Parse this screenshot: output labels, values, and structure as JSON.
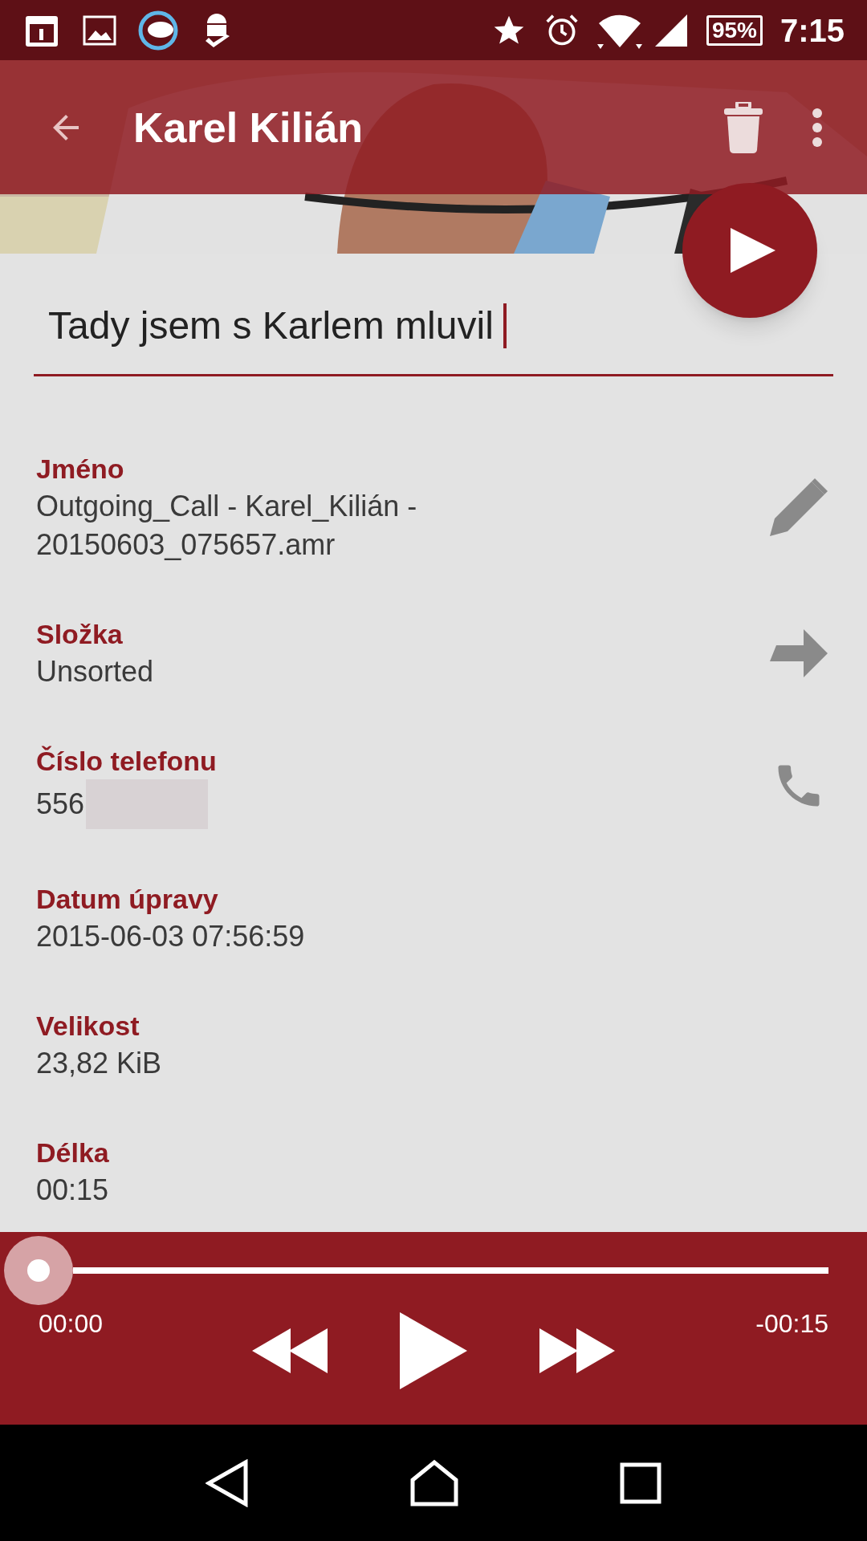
{
  "status_bar": {
    "battery": "95%",
    "time": "7:15"
  },
  "toolbar": {
    "title": "Karel Kilián"
  },
  "note_field": {
    "value": "Tady jsem s Karlem mluvil"
  },
  "fields": [
    {
      "label": "Jméno",
      "value": "Outgoing_Call - Karel_Kilián - 20150603_075657.amr",
      "kind": "edit"
    },
    {
      "label": "Složka",
      "value": "Unsorted",
      "kind": "move"
    },
    {
      "label": "Číslo telefonu",
      "value": "556",
      "kind": "call",
      "redacted": true
    },
    {
      "label": "Datum úpravy",
      "value": "2015-06-03 07:56:59",
      "kind": "plain"
    },
    {
      "label": "Velikost",
      "value": "23,82 KiB",
      "kind": "plain"
    },
    {
      "label": "Délka",
      "value": "00:15",
      "kind": "plain"
    }
  ],
  "player": {
    "elapsed": "00:00",
    "remaining": "-00:15"
  }
}
